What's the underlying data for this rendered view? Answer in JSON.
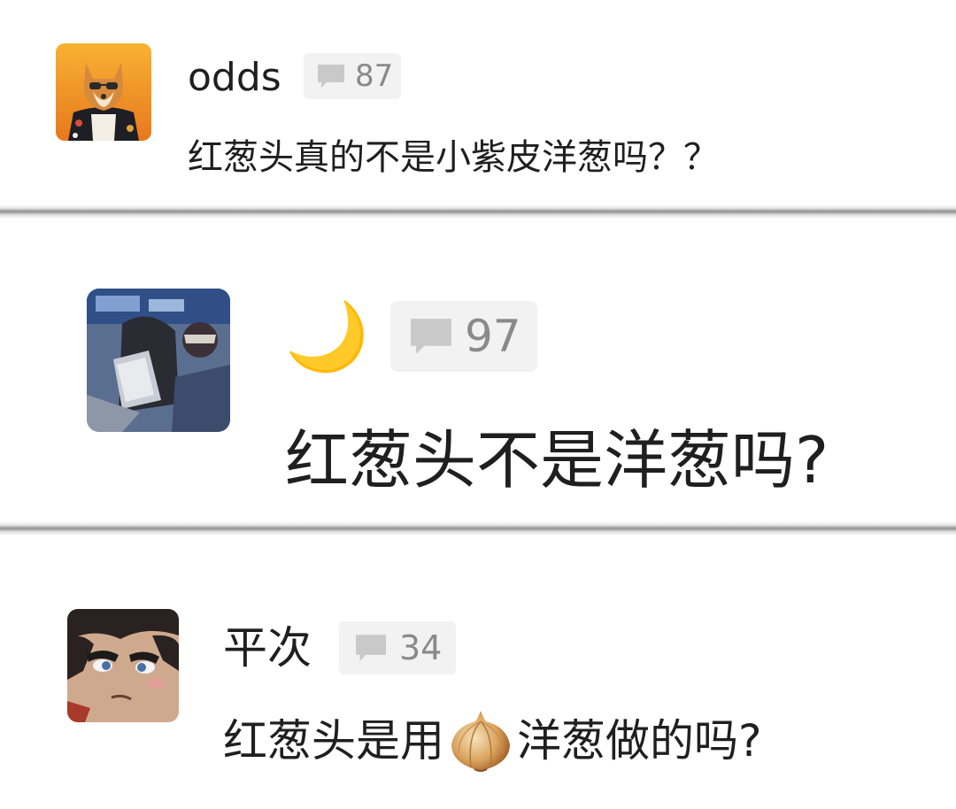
{
  "comments": [
    {
      "username": "odds",
      "reply_count": "87",
      "message": "红葱头真的不是小紫皮洋葱吗？？",
      "avatar": "shiba-dog-avatar-icon"
    },
    {
      "username": "🌙",
      "reply_count": "97",
      "message": "红葱头不是洋葱吗?",
      "avatar": "anime-scene-avatar-icon"
    },
    {
      "username": "平次",
      "reply_count": "34",
      "message_before_icon": "红葱头是用",
      "message_after_icon": "洋葱做的吗?",
      "message_icon": "onion-icon",
      "avatar": "anime-boy-avatar-icon"
    }
  ],
  "colors": {
    "badge_background": "#f2f2f2",
    "badge_text": "#8a8a8a",
    "text": "#1f1f1f"
  }
}
